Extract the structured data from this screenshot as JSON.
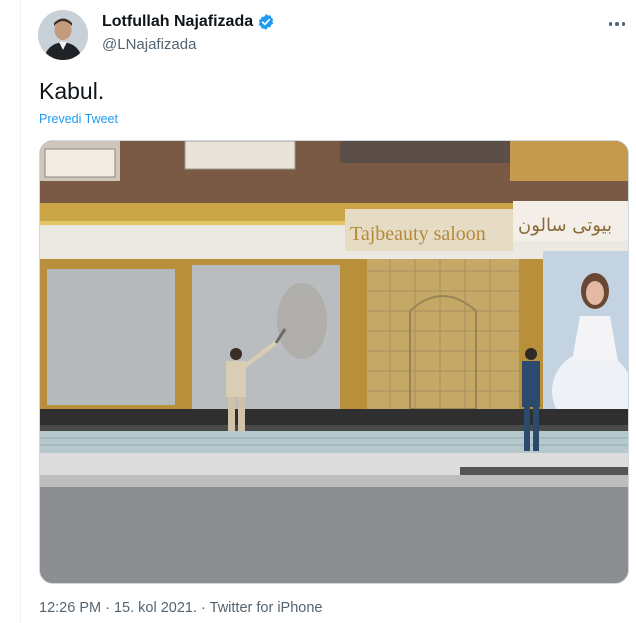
{
  "author": {
    "name": "Lotfullah Najafizada",
    "handle": "@LNajafizada",
    "verified": true
  },
  "icons": {
    "verified": "verified-badge-icon",
    "more": "more-options-icon"
  },
  "colors": {
    "accent": "#1d9bf0",
    "text": "#0f1419",
    "secondary": "#536471"
  },
  "tweet": {
    "text": "Kabul.",
    "translate_label": "Prevedi Tweet"
  },
  "photo": {
    "sign_latin": "Tajbeauty saloon",
    "sign_arabic": "بیوتی سالون"
  },
  "meta": {
    "time": "12:26 PM",
    "separator": " · ",
    "date": "15. kol 2021.",
    "source": "Twitter for iPhone"
  }
}
